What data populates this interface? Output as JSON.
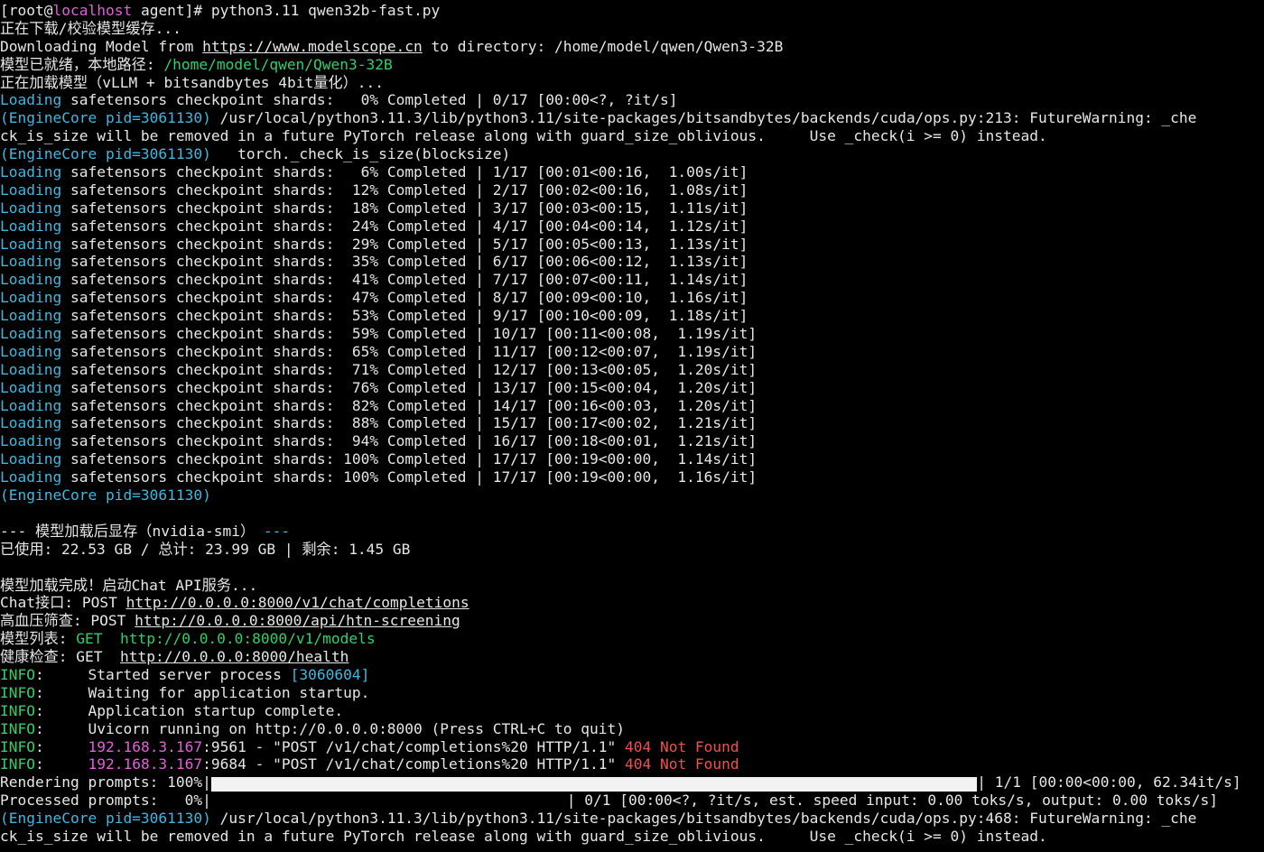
{
  "terminal": {
    "lines": [
      [
        {
          "t": "[root@"
        },
        {
          "t": "localhost",
          "c": "mag"
        },
        {
          "t": " agent]# python3.11 qwen32b-fast.py"
        }
      ],
      [
        {
          "t": "正在下载/校验模型缓存..."
        }
      ],
      [
        {
          "t": "Downloading Model from "
        },
        {
          "t": "https://www.modelscope.cn",
          "u": true
        },
        {
          "t": " to directory: /home/model/qwen/Qwen3-32B"
        }
      ],
      [
        {
          "t": "模型已就绪，本地路径: "
        },
        {
          "t": "/home/model/qwen/Qwen3-32B",
          "c": "green"
        }
      ],
      [
        {
          "t": "正在加载模型（vLLM + bitsandbytes 4bit量化）..."
        }
      ],
      [
        {
          "t": "Loading",
          "c": "cyan"
        },
        {
          "t": " safetensors checkpoint shards:   0% Completed | 0/17 [00:00<?, ?it/s]"
        }
      ],
      [
        {
          "t": "(EngineCore pid=3061130)",
          "c": "cyan"
        },
        {
          "t": " /usr/local/python3.11.3/lib/python3.11/site-packages/bitsandbytes/backends/cuda/ops.py:213: FutureWarning: _che"
        }
      ],
      [
        {
          "t": "ck_is_size will be removed in a future PyTorch release along with guard_size_oblivious.     Use _check(i >= 0) instead."
        }
      ],
      [
        {
          "t": "(EngineCore pid=3061130)",
          "c": "cyan"
        },
        {
          "t": "   torch._check_is_size(blocksize)"
        }
      ],
      [
        {
          "t": "Loading",
          "c": "cyan"
        },
        {
          "t": " safetensors checkpoint shards:   6% Completed | 1/17 [00:01<00:16,  1.00s/it]"
        }
      ],
      [
        {
          "t": "Loading",
          "c": "cyan"
        },
        {
          "t": " safetensors checkpoint shards:  12% Completed | 2/17 [00:02<00:16,  1.08s/it]"
        }
      ],
      [
        {
          "t": "Loading",
          "c": "cyan"
        },
        {
          "t": " safetensors checkpoint shards:  18% Completed | 3/17 [00:03<00:15,  1.11s/it]"
        }
      ],
      [
        {
          "t": "Loading",
          "c": "cyan"
        },
        {
          "t": " safetensors checkpoint shards:  24% Completed | 4/17 [00:04<00:14,  1.12s/it]"
        }
      ],
      [
        {
          "t": "Loading",
          "c": "cyan"
        },
        {
          "t": " safetensors checkpoint shards:  29% Completed | 5/17 [00:05<00:13,  1.13s/it]"
        }
      ],
      [
        {
          "t": "Loading",
          "c": "cyan"
        },
        {
          "t": " safetensors checkpoint shards:  35% Completed | 6/17 [00:06<00:12,  1.13s/it]"
        }
      ],
      [
        {
          "t": "Loading",
          "c": "cyan"
        },
        {
          "t": " safetensors checkpoint shards:  41% Completed | 7/17 [00:07<00:11,  1.14s/it]"
        }
      ],
      [
        {
          "t": "Loading",
          "c": "cyan"
        },
        {
          "t": " safetensors checkpoint shards:  47% Completed | 8/17 [00:09<00:10,  1.16s/it]"
        }
      ],
      [
        {
          "t": "Loading",
          "c": "cyan"
        },
        {
          "t": " safetensors checkpoint shards:  53% Completed | 9/17 [00:10<00:09,  1.18s/it]"
        }
      ],
      [
        {
          "t": "Loading",
          "c": "cyan"
        },
        {
          "t": " safetensors checkpoint shards:  59% Completed | 10/17 [00:11<00:08,  1.19s/it]"
        }
      ],
      [
        {
          "t": "Loading",
          "c": "cyan"
        },
        {
          "t": " safetensors checkpoint shards:  65% Completed | 11/17 [00:12<00:07,  1.19s/it]"
        }
      ],
      [
        {
          "t": "Loading",
          "c": "cyan"
        },
        {
          "t": " safetensors checkpoint shards:  71% Completed | 12/17 [00:13<00:05,  1.20s/it]"
        }
      ],
      [
        {
          "t": "Loading",
          "c": "cyan"
        },
        {
          "t": " safetensors checkpoint shards:  76% Completed | 13/17 [00:15<00:04,  1.20s/it]"
        }
      ],
      [
        {
          "t": "Loading",
          "c": "cyan"
        },
        {
          "t": " safetensors checkpoint shards:  82% Completed | 14/17 [00:16<00:03,  1.20s/it]"
        }
      ],
      [
        {
          "t": "Loading",
          "c": "cyan"
        },
        {
          "t": " safetensors checkpoint shards:  88% Completed | 15/17 [00:17<00:02,  1.21s/it]"
        }
      ],
      [
        {
          "t": "Loading",
          "c": "cyan"
        },
        {
          "t": " safetensors checkpoint shards:  94% Completed | 16/17 [00:18<00:01,  1.21s/it]"
        }
      ],
      [
        {
          "t": "Loading",
          "c": "cyan"
        },
        {
          "t": " safetensors checkpoint shards: 100% Completed | 17/17 [00:19<00:00,  1.14s/it]"
        }
      ],
      [
        {
          "t": "Loading",
          "c": "cyan"
        },
        {
          "t": " safetensors checkpoint shards: 100% Completed | 17/17 [00:19<00:00,  1.16s/it]"
        }
      ],
      [
        {
          "t": "(EngineCore pid=3061130)",
          "c": "cyan"
        }
      ],
      [],
      [
        {
          "t": "--- 模型加载后显存（nvidia-smi） "
        },
        {
          "t": "---",
          "c": "cyan"
        }
      ],
      [
        {
          "t": "已使用: 22.53 GB / 总计: 23.99 GB | 剩余: 1.45 GB"
        }
      ],
      [],
      [
        {
          "t": "模型加载完成！启动Chat API服务..."
        }
      ],
      [
        {
          "t": "Chat接口: POST "
        },
        {
          "t": "http://0.0.0.0:8000/v1/chat/completions",
          "u": true
        }
      ],
      [
        {
          "t": "高血压筛查: POST "
        },
        {
          "t": "http://0.0.0.0:8000/api/htn-screening",
          "u": true
        }
      ],
      [
        {
          "t": "模型列表: "
        },
        {
          "t": "GET  http://0.0.0.0:8000/v1/models",
          "c": "green"
        }
      ],
      [
        {
          "t": "健康检查: GET  "
        },
        {
          "t": "http://0.0.0.0:8000/health",
          "u": true
        }
      ],
      [
        {
          "t": "INFO",
          "c": "green"
        },
        {
          "t": ":     Started server process "
        },
        {
          "t": "[3060604]",
          "c": "cyan"
        }
      ],
      [
        {
          "t": "INFO",
          "c": "green"
        },
        {
          "t": ":     Waiting for application startup."
        }
      ],
      [
        {
          "t": "INFO",
          "c": "green"
        },
        {
          "t": ":     Application startup complete."
        }
      ],
      [
        {
          "t": "INFO",
          "c": "green"
        },
        {
          "t": ":     Uvicorn running on http://0.0.0.0:8000 (Press CTRL+C to quit)"
        }
      ],
      [
        {
          "t": "INFO",
          "c": "green"
        },
        {
          "t": ":     "
        },
        {
          "t": "192.168.3.167",
          "c": "mag"
        },
        {
          "t": ":9561 - \"POST /v1/chat/completions%20 HTTP/1.1\" "
        },
        {
          "t": "404 Not Found",
          "c": "red"
        }
      ],
      [
        {
          "t": "INFO",
          "c": "green"
        },
        {
          "t": ":     "
        },
        {
          "t": "192.168.3.167",
          "c": "mag"
        },
        {
          "t": ":9684 - \"POST /v1/chat/completions%20 HTTP/1.1\" "
        },
        {
          "t": "404 Not Found",
          "c": "red"
        }
      ],
      [
        {
          "t": "Rendering prompts: 100%|"
        },
        {
          "bar": 1.0,
          "w": 84
        },
        {
          "t": "| 1/1 [00:00<00:00, 62.34it/s]"
        }
      ],
      [
        {
          "t": "Processed prompts:   0%|"
        },
        {
          "bar": 0.0,
          "w": 39
        },
        {
          "t": "| 0/1 [00:00<?, ?it/s, est. speed input: 0.00 toks/s, output: 0.00 toks/s]"
        }
      ],
      [
        {
          "t": "(EngineCore pid=3061130)",
          "c": "cyan"
        },
        {
          "t": " /usr/local/python3.11.3/lib/python3.11/site-packages/bitsandbytes/backends/cuda/ops.py:468: FutureWarning: _che"
        }
      ],
      [
        {
          "t": "ck_is_size will be removed in a future PyTorch release along with guard_size_oblivious.     Use _check(i >= 0) instead."
        }
      ]
    ]
  }
}
